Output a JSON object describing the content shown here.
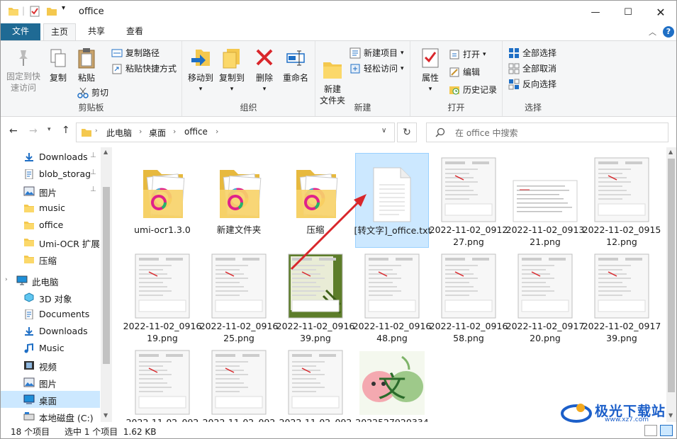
{
  "window": {
    "title": "office"
  },
  "ribbon_tabs": [
    "文件",
    "主页",
    "共享",
    "查看"
  ],
  "ribbon": {
    "clipboard": {
      "pin_label": "固定到快速访问",
      "copy_label": "复制",
      "paste_label": "粘贴",
      "copy_path_label": "复制路径",
      "paste_shortcut_label": "粘贴快捷方式",
      "cut_label": "剪切",
      "group_label": "剪贴板"
    },
    "organize": {
      "move_label": "移动到",
      "copy_to_label": "复制到",
      "delete_label": "删除",
      "rename_label": "重命名",
      "group_label": "组织"
    },
    "new": {
      "new_folder_label": "新建\n文件夹",
      "new_item_label": "新建项目",
      "easy_access_label": "轻松访问",
      "group_label": "新建"
    },
    "open": {
      "properties_label": "属性",
      "open_label": "打开",
      "edit_label": "编辑",
      "history_label": "历史记录",
      "group_label": "打开"
    },
    "select": {
      "select_all_label": "全部选择",
      "select_none_label": "全部取消",
      "invert_label": "反向选择",
      "group_label": "选择"
    }
  },
  "address": {
    "crumbs": [
      "此电脑",
      "桌面",
      "office"
    ],
    "search_placeholder": "在 office 中搜索"
  },
  "nav": {
    "items": [
      {
        "label": "Downloads",
        "icon": "download-icon",
        "pinned": true
      },
      {
        "label": "blob_storag",
        "icon": "document-icon",
        "pinned": true
      },
      {
        "label": "图片",
        "icon": "pictures-icon",
        "pinned": true
      },
      {
        "label": "music",
        "icon": "folder-icon",
        "pinned": false
      },
      {
        "label": "office",
        "icon": "folder-icon",
        "pinned": false
      },
      {
        "label": "Umi-OCR 扩展€",
        "icon": "folder-icon",
        "pinned": false
      },
      {
        "label": "压缩",
        "icon": "folder-icon",
        "pinned": false
      },
      {
        "label": "此电脑",
        "icon": "computer-icon",
        "pinned": false
      },
      {
        "label": "3D 对象",
        "icon": "3d-objects-icon",
        "pinned": false
      },
      {
        "label": "Documents",
        "icon": "document-icon",
        "pinned": false
      },
      {
        "label": "Downloads",
        "icon": "download-icon",
        "pinned": false
      },
      {
        "label": "Music",
        "icon": "music-icon",
        "pinned": false
      },
      {
        "label": "视频",
        "icon": "video-icon",
        "pinned": false
      },
      {
        "label": "图片",
        "icon": "pictures-icon",
        "pinned": false
      },
      {
        "label": "桌面",
        "icon": "desktop-icon",
        "pinned": false
      },
      {
        "label": "本地磁盘 (C:)",
        "icon": "drive-icon",
        "pinned": false
      }
    ]
  },
  "files": [
    {
      "name": "umi-ocr1.3.0",
      "kind": "folder"
    },
    {
      "name": "新建文件夹",
      "kind": "folder"
    },
    {
      "name": "压缩",
      "kind": "folder"
    },
    {
      "name": "[转文字]_office.txt",
      "kind": "txt",
      "selected": true
    },
    {
      "name": "2022-11-02_091227.png",
      "kind": "screenshot"
    },
    {
      "name": "2022-11-02_091321.png",
      "kind": "doc-shot"
    },
    {
      "name": "2022-11-02_091512.png",
      "kind": "screenshot"
    },
    {
      "name": "2022-11-02_091619.png",
      "kind": "screenshot"
    },
    {
      "name": "2022-11-02_091625.png",
      "kind": "screenshot"
    },
    {
      "name": "2022-11-02_091639.png",
      "kind": "green-shot"
    },
    {
      "name": "2022-11-02_091648.png",
      "kind": "screenshot"
    },
    {
      "name": "2022-11-02_091658.png",
      "kind": "screenshot"
    },
    {
      "name": "2022-11-02_091720.png",
      "kind": "screenshot"
    },
    {
      "name": "2022-11-02_091739.png",
      "kind": "screenshot"
    },
    {
      "name": "2022-11-02_092",
      "kind": "screenshot"
    },
    {
      "name": "2022-11-02_092",
      "kind": "screenshot"
    },
    {
      "name": "2022-11-02_092",
      "kind": "screenshot"
    },
    {
      "name": "2022527920334",
      "kind": "photo"
    }
  ],
  "status": {
    "count": "18 个项目",
    "selection": "选中 1 个项目  1.62 KB"
  },
  "watermark": {
    "text": "极光下载站",
    "url": "www.xz7.com"
  },
  "colors": {
    "accent": "#1f6a94",
    "selected": "#cce8ff",
    "folder": "#f7d26a",
    "arrow": "#d9262b"
  }
}
